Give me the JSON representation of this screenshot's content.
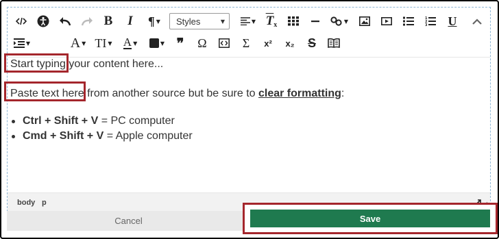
{
  "toolbar": {
    "styles_label": "Styles",
    "row1": [
      {
        "icon": "source-code-icon"
      },
      {
        "icon": "accessibility-icon"
      },
      {
        "icon": "undo-icon"
      },
      {
        "icon": "redo-icon"
      },
      {
        "icon": "bold-icon",
        "glyph": "B"
      },
      {
        "icon": "italic-icon",
        "glyph": "I"
      },
      {
        "icon": "paragraph-format-icon",
        "glyph": "¶"
      },
      {
        "icon": "align-icon"
      },
      {
        "icon": "clear-formatting-icon",
        "glyph": "T"
      },
      {
        "icon": "table-icon"
      },
      {
        "icon": "horizontal-line-icon"
      },
      {
        "icon": "link-icon"
      },
      {
        "icon": "image-icon"
      },
      {
        "icon": "video-icon"
      },
      {
        "icon": "bulleted-list-icon"
      },
      {
        "icon": "numbered-list-icon"
      },
      {
        "icon": "underline-icon",
        "glyph": "U"
      },
      {
        "icon": "collapse-toolbar-icon"
      }
    ],
    "row2": [
      {
        "icon": "indent-icon"
      },
      {
        "icon": "font-family-icon",
        "glyph": "A"
      },
      {
        "icon": "font-size-icon",
        "glyph": "TI"
      },
      {
        "icon": "text-color-icon",
        "glyph": "A"
      },
      {
        "icon": "background-color-icon"
      },
      {
        "icon": "blockquote-icon",
        "glyph": "❞"
      },
      {
        "icon": "special-character-icon",
        "glyph": "Ω"
      },
      {
        "icon": "embed-code-icon"
      },
      {
        "icon": "math-equation-icon",
        "glyph": "Σ"
      },
      {
        "icon": "superscript-icon",
        "glyph": "x²"
      },
      {
        "icon": "subscript-icon",
        "glyph": "x₂"
      },
      {
        "icon": "strikethrough-icon",
        "glyph": "S"
      },
      {
        "icon": "book-icon"
      }
    ]
  },
  "content": {
    "line1_highlight": "Start typing",
    "line1_rest": " your content here...",
    "line2_highlight": "Paste text here",
    "line2_mid": " from another source but be sure to ",
    "line2_link": "clear formatting",
    "line2_end": ":",
    "bullets": [
      {
        "bold": "Ctrl + Shift + V",
        "rest": " = PC computer"
      },
      {
        "bold": "Cmd + Shift + V",
        "rest": " = Apple computer"
      }
    ]
  },
  "statusbar": {
    "path": [
      "body",
      "p"
    ]
  },
  "footer": {
    "cancel_label": "Cancel",
    "save_label": "Save"
  },
  "colors": {
    "save_green": "#1f7a4f",
    "highlight_red": "#a4262c",
    "editor_border": "#8fb7d6"
  }
}
